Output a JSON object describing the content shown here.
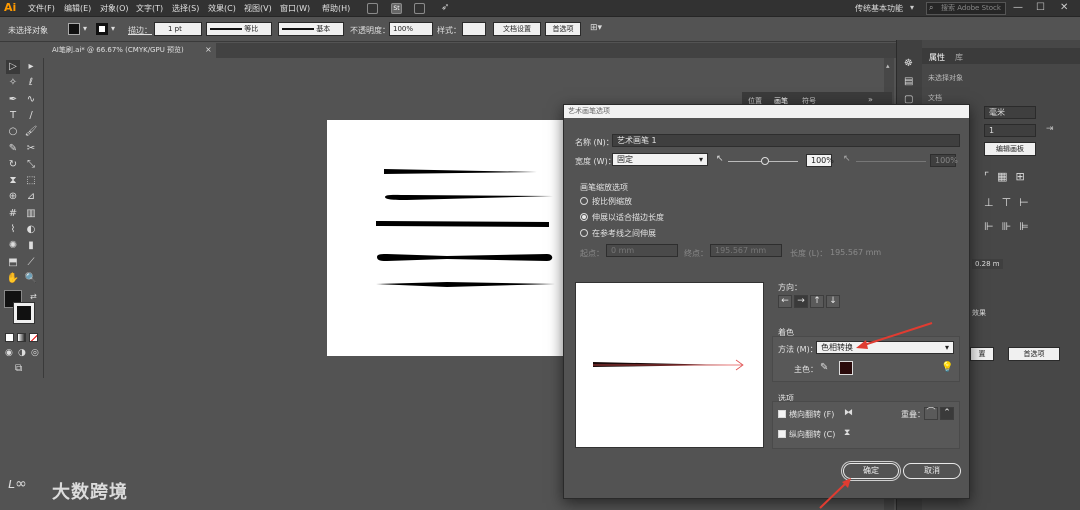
{
  "app": {
    "logo": "Ai"
  },
  "menu": [
    "文件(F)",
    "编辑(E)",
    "对象(O)",
    "文字(T)",
    "选择(S)",
    "效果(C)",
    "视图(V)",
    "窗口(W)",
    "帮助(H)"
  ],
  "menu_icons": [
    "br-icon",
    "stock-icon",
    "layout-icon",
    "send-icon"
  ],
  "workspace": "传统基本功能",
  "search": {
    "placeholder": "搜索 Adobe Stock"
  },
  "control_bar": {
    "selection_status": "未选择对象",
    "stroke_label": "描边：",
    "stroke_weight": "1 pt",
    "profile_label": "等比",
    "brush_label": "基本",
    "opacity_label": "不透明度：",
    "opacity_value": "100%",
    "style_label": "样式：",
    "doc_setup": "文档设置",
    "preferences": "首选项"
  },
  "document_tab": {
    "title": "AI笔刷.ai* @ 66.67% (CMYK/GPU 预览)",
    "close": "×"
  },
  "right_panel": {
    "tabs": [
      "属性",
      "库"
    ],
    "no_selection": "未选择对象",
    "doc_label": "文档",
    "units": "毫米",
    "artboard_num": "1",
    "edit_artboard": "编辑画板",
    "value_partial": "0.28 m",
    "btn_left": "置",
    "btn_right": "首选项",
    "hint": "效果"
  },
  "brush_panel_tabs": [
    "位置",
    "画笔",
    "符号"
  ],
  "dialog": {
    "title": "艺术画笔选项",
    "name_label": "名称 (N)：",
    "name_value": "艺术画笔 1",
    "width_label": "宽度 (W)：",
    "width_mode": "固定",
    "width_value": "100%",
    "width_value2": "100%",
    "scale_group_title": "画笔缩放选项",
    "scale_options": [
      "按比例缩放",
      "伸展以适合描边长度",
      "在参考线之间伸展"
    ],
    "scale_selected": 1,
    "start_label": "起点：",
    "start_value": "0 mm",
    "end_label": "终点：",
    "end_value": "195.567 mm",
    "length_label": "长度 (L)：",
    "length_value": "195.567 mm",
    "direction_label": "方向：",
    "directions": [
      "←",
      "→",
      "↑",
      "↓"
    ],
    "direction_selected": 1,
    "colorize_title": "着色",
    "method_label": "方法 (M)：",
    "method_value": "色相转换",
    "key_color_label": "主色：",
    "key_color": "#2a0a0a",
    "options_title": "选项",
    "flip_along": "横向翻转 (F)",
    "flip_across": "纵向翻转 (C)",
    "overlap_label": "重叠：",
    "ok": "确定",
    "cancel": "取消"
  },
  "watermark": "大数跨境",
  "colors": {
    "accent_arrow": "#e03c31",
    "canvas": "#535353",
    "preview_stroke": "#1a0a0a"
  }
}
